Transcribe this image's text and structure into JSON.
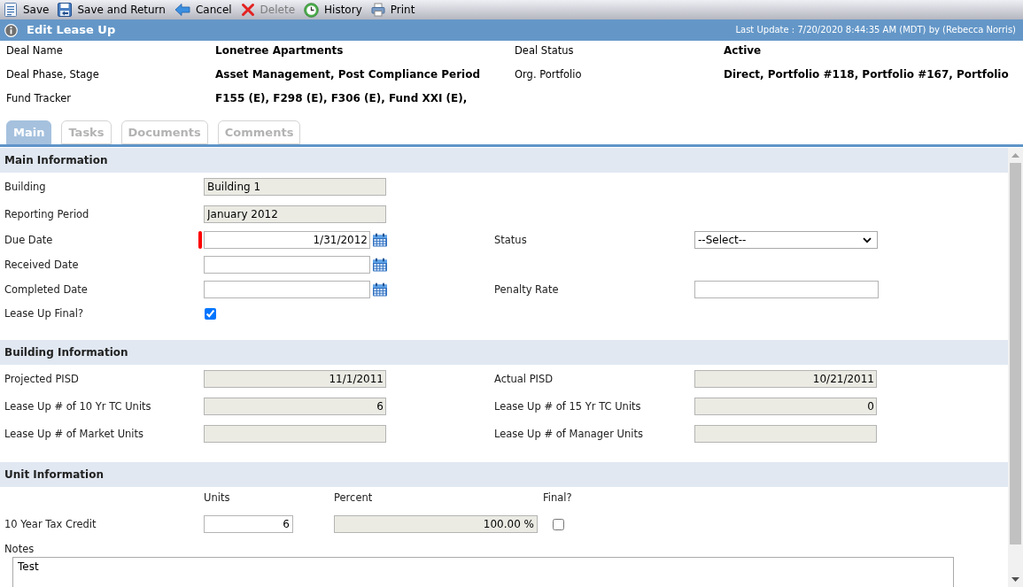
{
  "toolbar": [
    {
      "label": "Save",
      "disabled": false
    },
    {
      "label": "Save and Return",
      "disabled": false
    },
    {
      "label": "Cancel",
      "disabled": false
    },
    {
      "label": "Delete",
      "disabled": true
    },
    {
      "label": "History",
      "disabled": false
    },
    {
      "label": "Print",
      "disabled": false
    }
  ],
  "title_bar": {
    "title": "Edit Lease Up",
    "last_update": "Last Update : 7/20/2020 8:44:35 AM (MDT) by (Rebecca Norris)"
  },
  "deal_info": [
    {
      "label": "Deal Name",
      "value": "Lonetree Apartments"
    },
    {
      "label": "Deal Status",
      "value": "Active"
    },
    {
      "label": "Deal Phase, Stage",
      "value": "Asset Management, Post Compliance Period"
    },
    {
      "label": "Org. Portfolio",
      "value": "Direct, Portfolio #118, Portfolio #167, Portfolio"
    },
    {
      "label": "Fund Tracker",
      "value": "F155 (E), F298 (E), F306 (E), Fund XXI (E),"
    }
  ],
  "tabs": [
    {
      "label": "Main",
      "selected": true
    },
    {
      "label": "Tasks",
      "selected": false
    },
    {
      "label": "Documents",
      "selected": false
    },
    {
      "label": "Comments",
      "selected": false
    }
  ],
  "sections": [
    {
      "title": "Main Information",
      "rows": [
        {
          "fields": [
            {
              "label": "Building",
              "kind": "display",
              "value": "Building 1",
              "required": false
            }
          ]
        },
        {
          "fields": [
            {
              "label": "Reporting Period",
              "kind": "display",
              "value": "January 2012",
              "required": false
            }
          ]
        },
        {
          "fields": [
            {
              "label": "Due Date",
              "kind": "date",
              "value": "1/31/2012",
              "required": true
            },
            {
              "label": "Status",
              "kind": "select",
              "value": "--Select--",
              "required": false
            }
          ]
        },
        {
          "fields": [
            {
              "label": "Received Date",
              "kind": "date",
              "required": false
            }
          ]
        },
        {
          "fields": [
            {
              "label": "Completed Date",
              "kind": "date",
              "required": false
            },
            {
              "label": "Penalty Rate",
              "kind": "input",
              "required": false
            }
          ]
        },
        {
          "fields": [
            {
              "label": "Lease Up Final?",
              "kind": "checkbox",
              "checked": true,
              "required": false
            }
          ]
        }
      ]
    },
    {
      "title": "Building Information",
      "rows": [
        {
          "fields": [
            {
              "label": "Projected PISD",
              "kind": "numeric",
              "value": "11/1/2011",
              "required": false
            },
            {
              "label": "Actual PISD",
              "kind": "numeric",
              "value": "10/21/2011",
              "required": false
            }
          ]
        },
        {
          "fields": [
            {
              "label": "Lease Up # of 10 Yr TC Units",
              "kind": "numeric",
              "value": "6",
              "required": false
            },
            {
              "label": "Lease Up # of 15 Yr TC Units",
              "kind": "numeric",
              "value": "0",
              "required": false
            }
          ]
        },
        {
          "fields": [
            {
              "label": "Lease Up # of Market Units",
              "kind": "numeric",
              "required": false
            },
            {
              "label": "Lease Up # of Manager Units",
              "kind": "numeric",
              "required": false
            }
          ]
        }
      ]
    }
  ],
  "unit_section": {
    "title": "Unit Information",
    "columns": [
      "Units",
      "Percent",
      "Final?"
    ],
    "rows": [
      {
        "label": "10 Year Tax Credit",
        "units": "6",
        "percent": "100.00 %",
        "final": false
      }
    ],
    "notes": {
      "label": "Notes",
      "value": "Test"
    }
  }
}
